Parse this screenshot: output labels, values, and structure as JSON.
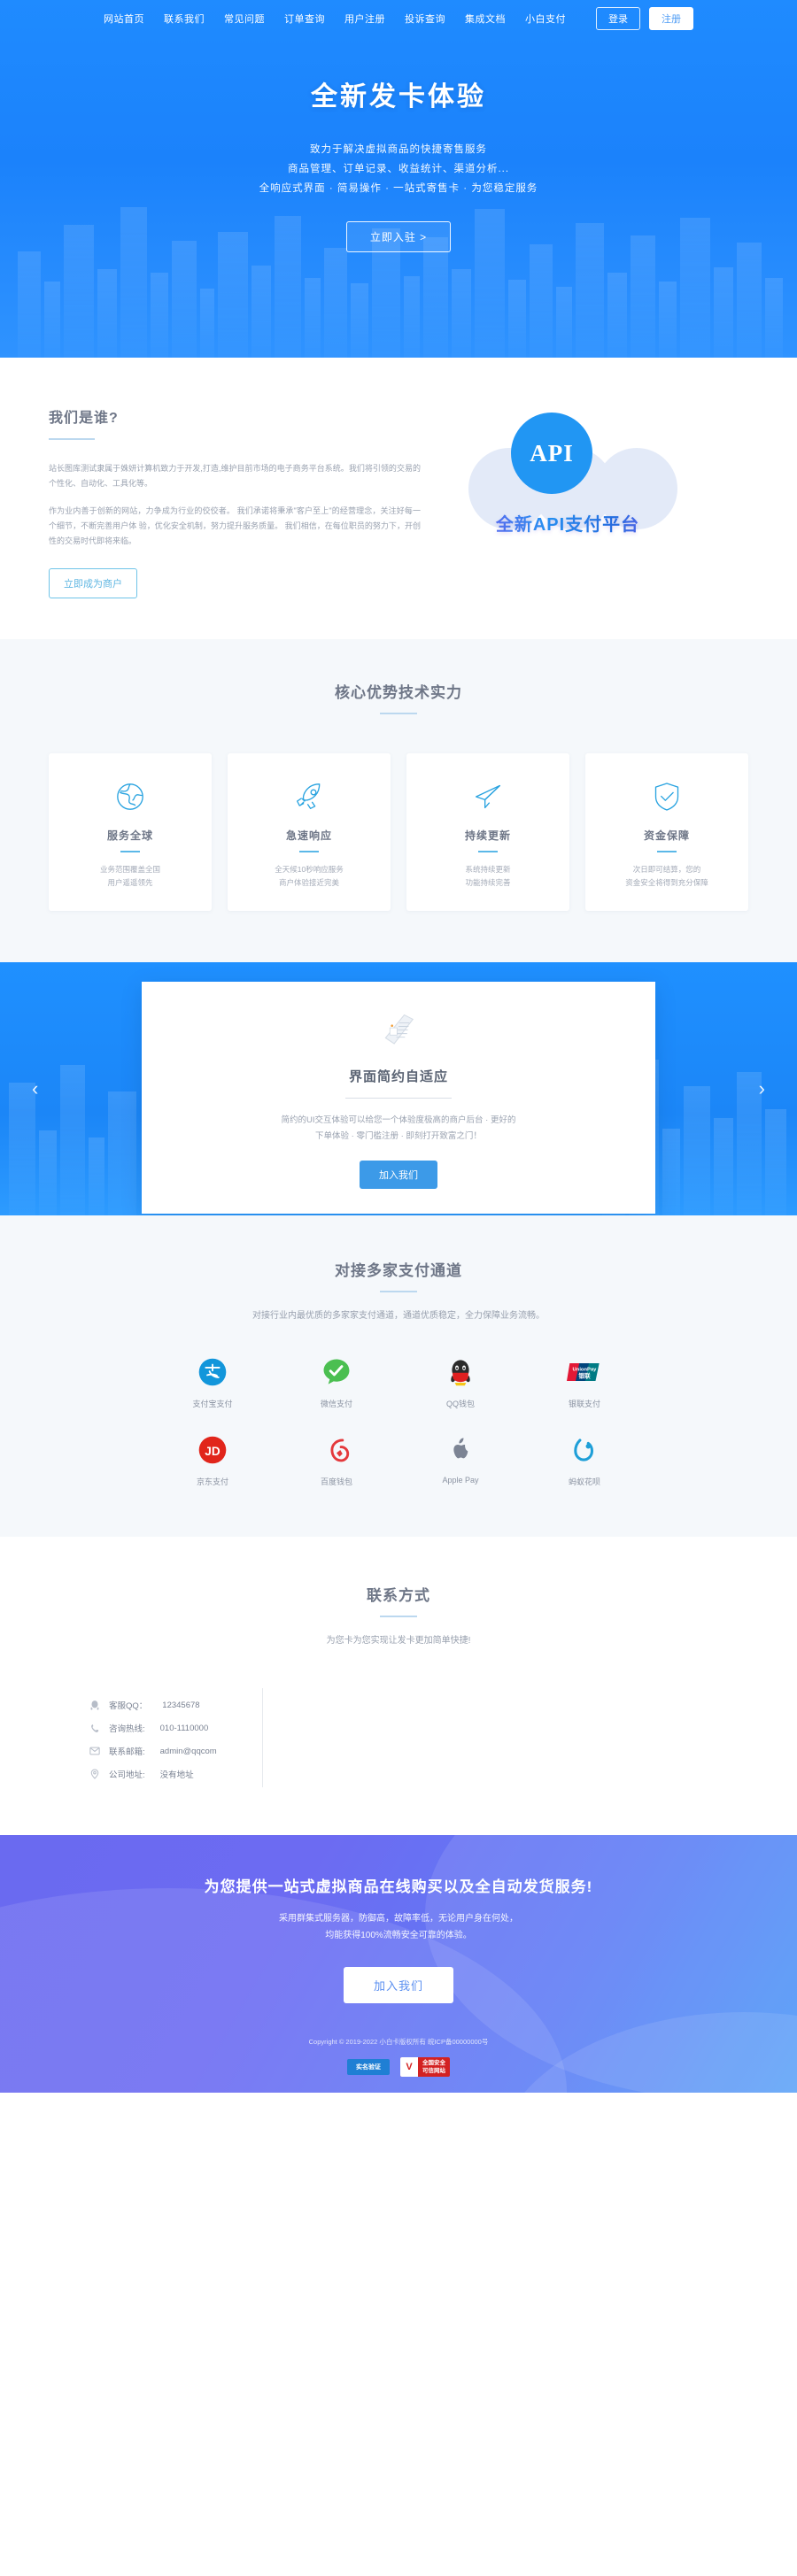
{
  "nav": {
    "links": [
      {
        "label": "网站首页"
      },
      {
        "label": "联系我们"
      },
      {
        "label": "常见问题"
      },
      {
        "label": "订单查询"
      },
      {
        "label": "用户注册"
      },
      {
        "label": "投诉查询"
      },
      {
        "label": "集成文档"
      },
      {
        "label": "小白支付"
      }
    ],
    "login_label": "登录",
    "register_label": "注册"
  },
  "hero": {
    "title": "全新发卡体验",
    "line1": "致力于解决虚拟商品的快捷寄售服务",
    "line2": "商品管理、订单记录、收益统计、渠道分析...",
    "line3": "全响应式界面 · 简易操作 · 一站式寄售卡 · 为您稳定服务",
    "cta_label": "立即入驻 >"
  },
  "who": {
    "heading": "我们是谁?",
    "paragraph1": "站长图库测试隶属于姝妍计算机致力于开发,打造,维护目前市场的电子商务平台系统。我们将引领的交易的个性化、自动化、工具化等。",
    "paragraph2": "作为业内善于创新的网站，力争成为行业的佼佼者。 我们承诺将秉承\"客户至上\"的经营理念，关注好每一个细节，不断完善用户体 验，优化安全机制，努力提升服务质量。 我们相信，在每位职员的努力下，开创性的交易时代即将来临。",
    "button_label": "立即成为商户",
    "api_badge": "API",
    "api_caption": "全新API支付平台"
  },
  "advantages": {
    "title": "核心优势技术实力",
    "cards": [
      {
        "icon": "globe-icon",
        "title": "服务全球",
        "line1": "业务范围覆盖全国",
        "line2": "用户遥遥领先"
      },
      {
        "icon": "rocket-icon",
        "title": "急速响应",
        "line1": "全天候10秒响应服务",
        "line2": "商户体验接近完美"
      },
      {
        "icon": "paper-plane-icon",
        "title": "持续更新",
        "line1": "系统持续更新",
        "line2": "功能持续完善"
      },
      {
        "icon": "shield-check-icon",
        "title": "资金保障",
        "line1": "次日即可结算，您的",
        "line2": "资金安全将得到充分保障"
      }
    ]
  },
  "slider": {
    "prev_label": "‹",
    "next_label": "›",
    "icon": "document-card-icon",
    "title": "界面简约自适应",
    "line1": "简约的UI交互体验可以给您一个体验度极高的商户后台 · 更好的",
    "line2": "下单体验 · 零门槛注册 · 即刻打开致富之门！",
    "button_label": "加入我们"
  },
  "payments": {
    "title": "对接多家支付通道",
    "subtitle": "对接行业内最优质的多家家支付通道，通道优质稳定，全力保障业务流畅。",
    "items": [
      {
        "icon": "alipay-icon",
        "label": "支付宝支付",
        "color": "#1296db"
      },
      {
        "icon": "wechat-pay-icon",
        "label": "微信支付",
        "color": "#4bbf51"
      },
      {
        "icon": "qq-wallet-icon",
        "label": "QQ钱包",
        "color": "#2b2b2b"
      },
      {
        "icon": "unionpay-icon",
        "label": "银联支付",
        "color": "#d52b2b"
      },
      {
        "icon": "jd-pay-icon",
        "label": "京东支付",
        "color": "#e1251b"
      },
      {
        "icon": "baidu-wallet-icon",
        "label": "百度钱包",
        "color": "#e4393c"
      },
      {
        "icon": "apple-pay-icon",
        "label": "Apple Pay",
        "color": "#7c8494"
      },
      {
        "icon": "huabei-icon",
        "label": "蚂蚁花呗",
        "color": "#1e9fd8"
      }
    ]
  },
  "contact": {
    "title": "联系方式",
    "subtitle": "为您卡为您实现让发卡更加简单快捷!",
    "rows": [
      {
        "icon": "qq-icon",
        "key": "客服QQ：",
        "value": "12345678"
      },
      {
        "icon": "phone-icon",
        "key": "咨询热线:",
        "value": "010-1110000"
      },
      {
        "icon": "mail-icon",
        "key": "联系邮箱:",
        "value": "admin@qqcom"
      },
      {
        "icon": "location-icon",
        "key": "公司地址:",
        "value": "没有地址"
      }
    ]
  },
  "bottom": {
    "heading": "为您提供一站式虚拟商品在线购买以及全自动发货服务!",
    "line1": "采用群集式服务器，防御高，故障率低，无论用户身在何处，",
    "line2": "均能获得100%流畅安全可靠的体验。",
    "button_label": "加入我们",
    "copyright": "Copyright © 2019-2022 小白卡版权所有 皖ICP备00000000号",
    "badge_realname": "实名验证",
    "badge_trusted_line1": "全国安全",
    "badge_trusted_line2": "可信网站"
  },
  "colors": {
    "primary": "#1f8bff",
    "accent": "#5bb8e8",
    "bottom_gradient_start": "#6a6af0",
    "bottom_gradient_end": "#4e9bf8"
  }
}
